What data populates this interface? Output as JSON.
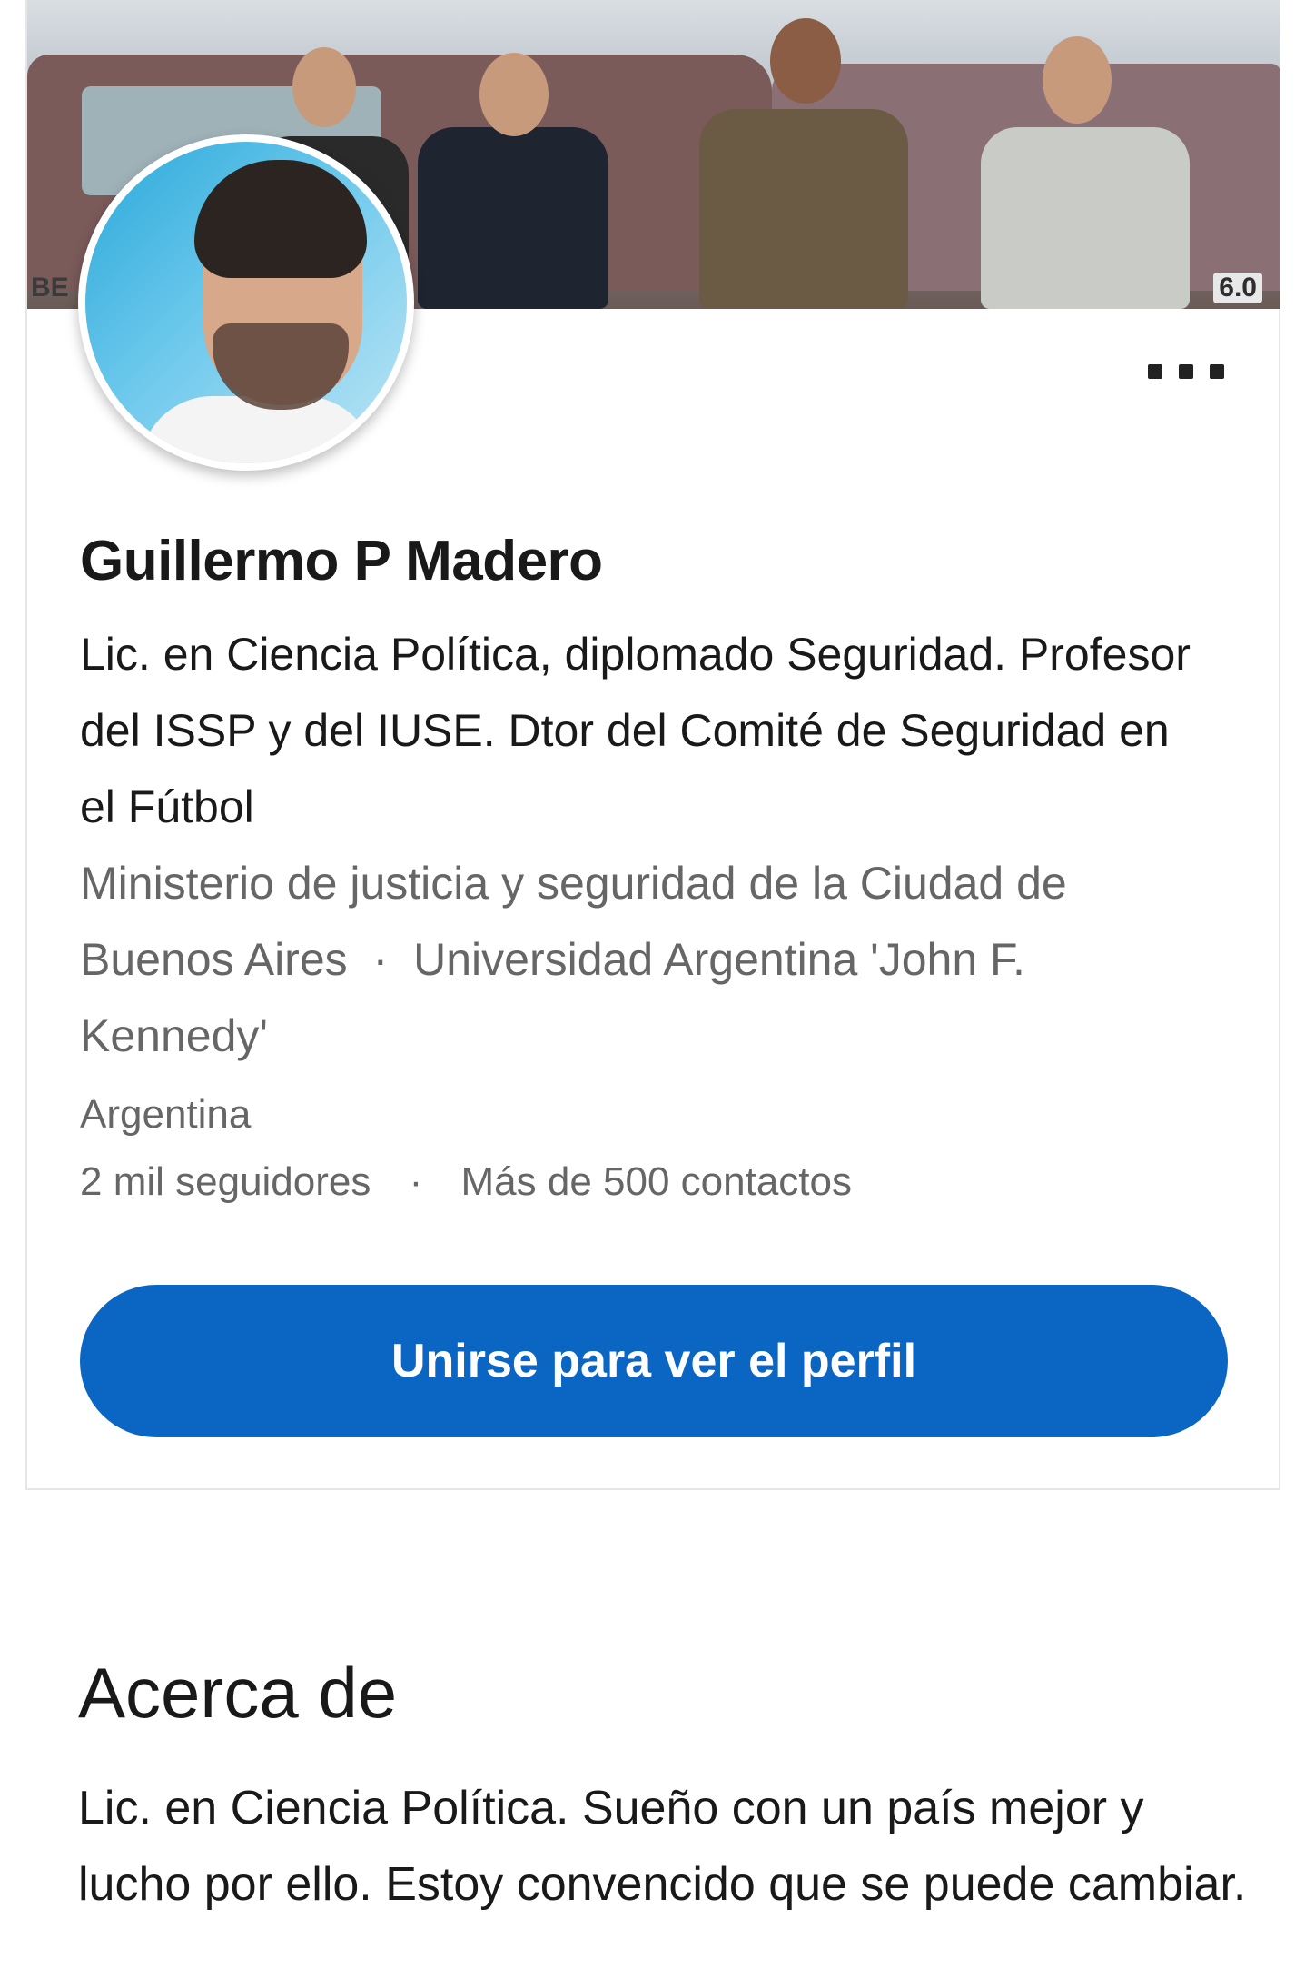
{
  "profile": {
    "name": "Guillermo P Madero",
    "headline": "Lic. en Ciencia Política, diplomado Seguridad. Profesor del ISSP y del IUSE. Dtor del Comité de Seguridad en el Fútbol",
    "affiliation_primary": "Ministerio de justicia y seguridad de la Ciudad de Buenos Aires",
    "affiliation_separator": "·",
    "affiliation_secondary": "Universidad Argentina 'John F. Kennedy'",
    "location": "Argentina",
    "followers": "2 mil seguidores",
    "stats_separator": "·",
    "connections": "Más de 500 contactos",
    "more_icon": "more-horizontal-icon",
    "cover_labels": {
      "left": "BE",
      "right": "6.0"
    }
  },
  "actions": {
    "join_label": "Unirse para ver el perfil"
  },
  "about": {
    "title": "Acerca de",
    "text": "Lic. en Ciencia Política. Sueño con un país mejor y lucho por ello. Estoy convencido que se puede cambiar."
  },
  "colors": {
    "primary_button": "#0a66c2",
    "text_primary": "#191919",
    "text_secondary": "#666666"
  }
}
